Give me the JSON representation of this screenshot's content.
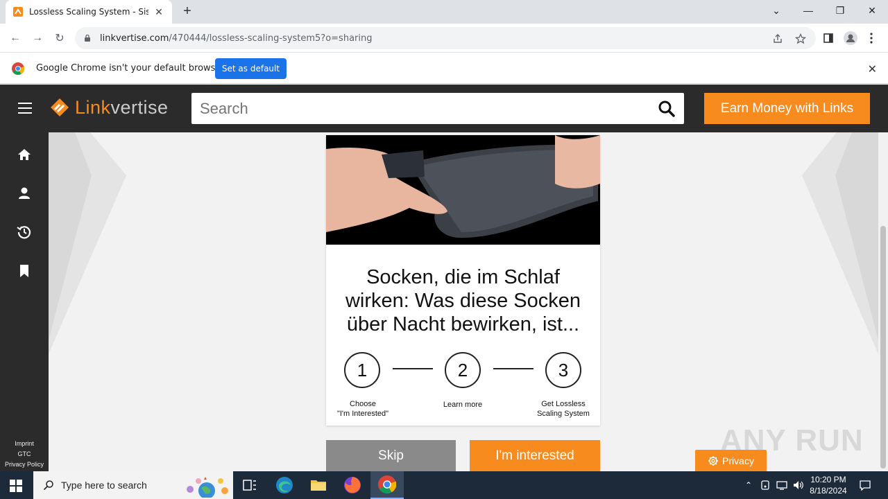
{
  "browser": {
    "tab_title": "Lossless Scaling System - Sistem",
    "url_domain": "linkvertise.com",
    "url_path": "/470444/lossless-scaling-system5?o=sharing"
  },
  "infobar": {
    "message": "Google Chrome isn't your default browser",
    "set_default_label": "Set as default"
  },
  "header": {
    "logo_link": "Link",
    "logo_vertise": "vertise",
    "search_placeholder": "Search",
    "earn_button": "Earn Money with Links"
  },
  "sidebar": {
    "items": [
      "home-icon",
      "profile-icon",
      "history-icon",
      "bookmark-icon"
    ],
    "footer": [
      "Imprint",
      "GTC",
      "Privacy Policy"
    ]
  },
  "ad": {
    "headline": "Socken, die im Schlaf wirken: Was diese Socken über Nacht bewirken, ist..."
  },
  "steps": [
    {
      "number": "1",
      "label_line1": "Choose",
      "label_line2": "\"I'm Interested\""
    },
    {
      "number": "2",
      "label_line1": "Learn more",
      "label_line2": ""
    },
    {
      "number": "3",
      "label_line1": "Get Lossless",
      "label_line2": "Scaling System"
    }
  ],
  "actions": {
    "skip": "Skip",
    "interested": "I'm interested",
    "privacy": "Privacy"
  },
  "watermark": "ANY RUN",
  "taskbar": {
    "search_placeholder": "Type here to search",
    "time": "10:20 PM",
    "date": "8/18/2024"
  },
  "colors": {
    "accent": "#f78b1e",
    "header_bg": "#2b2b2b",
    "chrome_blue": "#1a73e8"
  }
}
